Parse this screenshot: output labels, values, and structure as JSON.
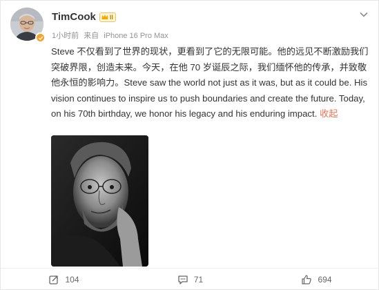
{
  "post": {
    "author": {
      "name": "TimCook",
      "badge_level": "II",
      "avatar": "avatar",
      "verified_icon": "verified-icon"
    },
    "meta": {
      "time": "1小时前",
      "source_prefix": "来自",
      "device": "iPhone 16 Pro Max"
    },
    "menu_icon": "chevron-down-icon",
    "text": "Steve 不仅看到了世界的现状，更看到了它的无限可能。他的远见不断激励我们突破界限，创造未来。今天，在他 70 岁诞辰之际，我们缅怀他的传承，并致敬他永恒的影响力。Steve saw the world not just as it was, but as it could be. His vision continues to inspire us to push boundaries and create the future. Today, on his 70th birthday, we honor his legacy and his enduring impact.",
    "collapse_label": "收起",
    "image": "black-and-white portrait photo"
  },
  "actions": {
    "repost_count": "104",
    "comment_count": "71",
    "like_count": "694"
  },
  "colors": {
    "accent": "#eb7350",
    "meta": "#939393",
    "verified": "#f7a325"
  }
}
